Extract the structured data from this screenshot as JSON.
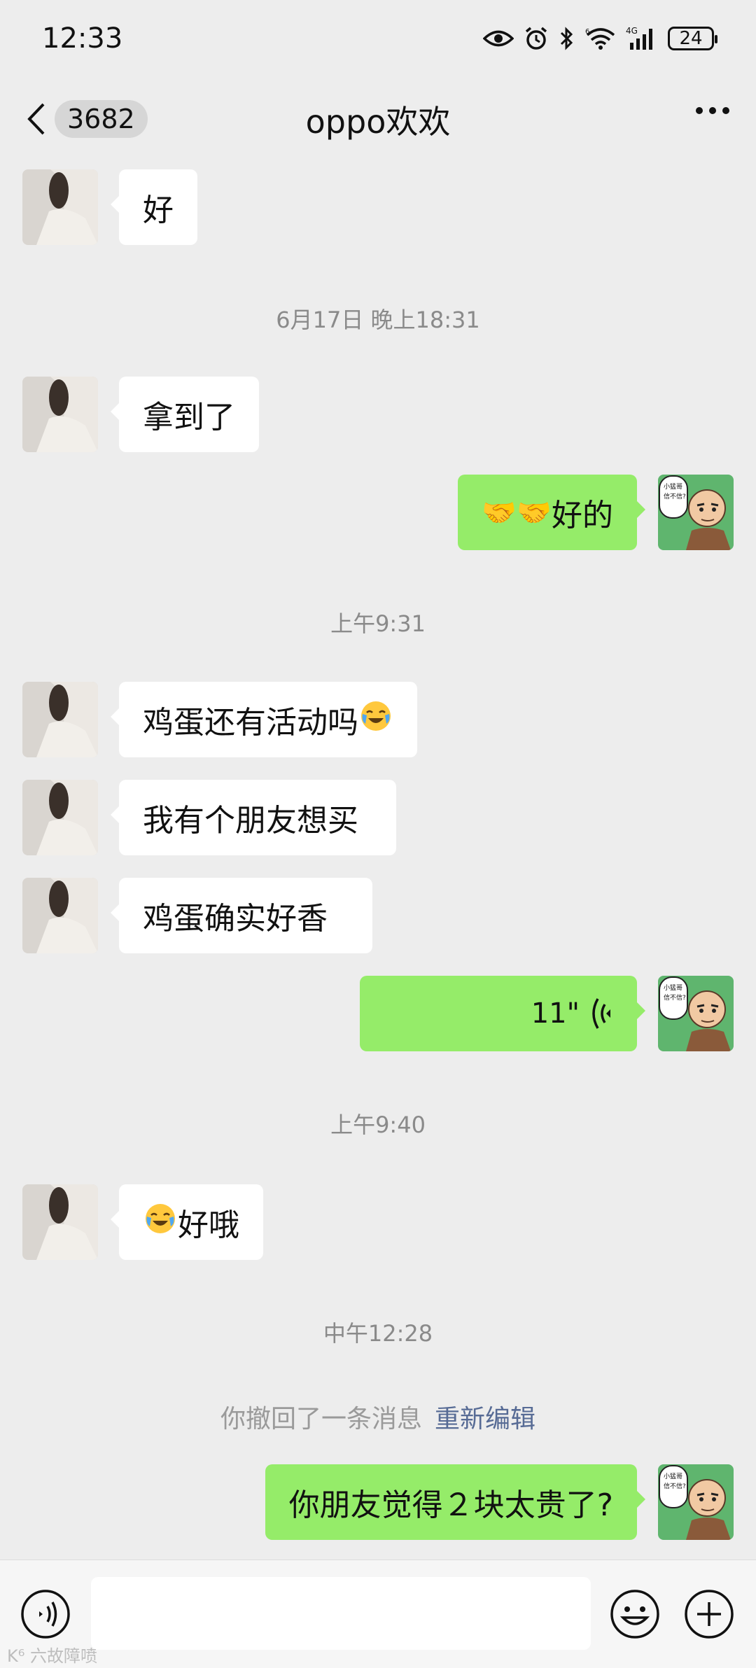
{
  "status": {
    "time": "12:33",
    "battery": "24",
    "net": "4G",
    "sim": "6"
  },
  "header": {
    "back_count": "3682",
    "title": "oppo欢欢"
  },
  "messages": {
    "m1": "好",
    "ts1": "6月17日 晚上18:31",
    "m2": "拿到了",
    "m3": "好的",
    "ts2": "上午9:31",
    "m4": "鸡蛋还有活动吗",
    "m5": "我有个朋友想买",
    "m6": "鸡蛋确实好香",
    "voice_duration": "11\"",
    "ts3": "上午9:40",
    "m7": "好哦",
    "ts4": "中午12:28",
    "recall_text": "你撤回了一条消息",
    "recall_edit": "重新编辑",
    "m8": "你朋友觉得２块太贵了?"
  },
  "avatar": {
    "right_caption": "小猛哥,信不信?"
  },
  "input": {
    "value": ""
  },
  "watermark": "K⁶ 六故障喷",
  "colors": {
    "sent_bubble": "#95ec69",
    "received_bubble": "#ffffff",
    "background": "#ededed",
    "link": "#576b95"
  },
  "icons": {
    "voice": "voice-icon",
    "emoji": "emoji-icon",
    "plus": "plus-icon",
    "back": "chevron-left-icon",
    "more": "more-icon"
  }
}
